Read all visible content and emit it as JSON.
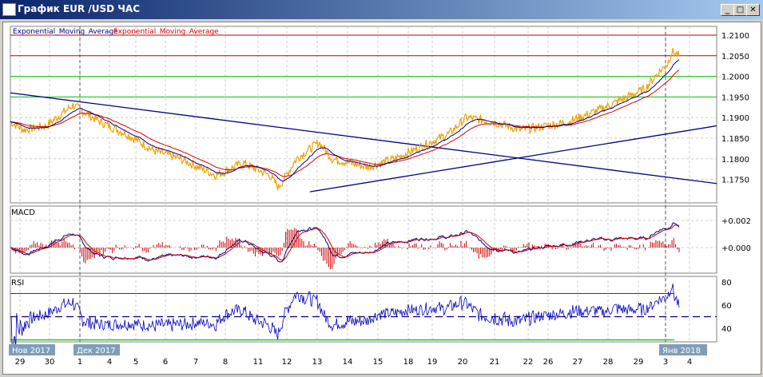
{
  "window": {
    "title": "График EUR /USD  ЧАС",
    "minimize": "_",
    "maximize": "□",
    "close": "✕"
  },
  "legend": {
    "ema1": "Exponential_Moving_Average",
    "ema2": "Exponential_Moving_Average",
    "ema1_color": "#000080",
    "ema2_color": "#e00000"
  },
  "panels": {
    "macd_label": "MACD",
    "rsi_label": "RSI"
  },
  "price_axis": [
    "1.2100",
    "1.2050",
    "1.2000",
    "1.1950",
    "1.1900",
    "1.1850",
    "1.1800",
    "1.1750"
  ],
  "macd_axis": [
    "+0.002",
    "+0.000"
  ],
  "rsi_axis": [
    "80",
    "60",
    "40"
  ],
  "months": [
    "Нов 2017",
    "Дек 2017",
    "Янв 2018"
  ],
  "dates": [
    "29",
    "30",
    "1",
    "4",
    "5",
    "6",
    "7",
    "8",
    "11",
    "12",
    "13",
    "14",
    "15",
    "18",
    "19",
    "20",
    "21",
    "22",
    "26",
    "27",
    "28",
    "29",
    "3",
    "4"
  ],
  "chart_data": {
    "type": "line",
    "price_range": [
      1.171,
      1.212
    ],
    "price_anchors": [
      [
        0,
        1.189
      ],
      [
        15,
        1.187
      ],
      [
        40,
        1.188
      ],
      [
        70,
        1.193
      ],
      [
        100,
        1.189
      ],
      [
        130,
        1.186
      ],
      [
        160,
        1.182
      ],
      [
        190,
        1.18
      ],
      [
        230,
        1.176
      ],
      [
        260,
        1.179
      ],
      [
        290,
        1.176
      ],
      [
        300,
        1.173
      ],
      [
        320,
        1.18
      ],
      [
        345,
        1.184
      ],
      [
        360,
        1.18
      ],
      [
        380,
        1.179
      ],
      [
        400,
        1.178
      ],
      [
        430,
        1.18
      ],
      [
        460,
        1.183
      ],
      [
        490,
        1.186
      ],
      [
        510,
        1.19
      ],
      [
        540,
        1.189
      ],
      [
        570,
        1.187
      ],
      [
        600,
        1.188
      ],
      [
        625,
        1.189
      ],
      [
        660,
        1.192
      ],
      [
        690,
        1.195
      ],
      [
        710,
        1.197
      ],
      [
        725,
        1.201
      ],
      [
        735,
        1.203
      ],
      [
        740,
        1.206
      ],
      [
        748,
        1.205
      ]
    ],
    "bars_total": 790,
    "horizontal_lines": [
      {
        "value": 1.21,
        "color": "#c00000"
      },
      {
        "value": 1.205,
        "color": "#c00000"
      },
      {
        "value": 1.2,
        "color": "#00c000"
      },
      {
        "value": 1.195,
        "color": "#00c000"
      }
    ],
    "trend_lines": [
      {
        "from": [
          0,
          1.196
        ],
        "to": [
          790,
          1.174
        ]
      },
      {
        "from": [
          335,
          1.172
        ],
        "to": [
          790,
          1.188
        ]
      }
    ],
    "rsi_levels": [
      70,
      50,
      30
    ]
  }
}
